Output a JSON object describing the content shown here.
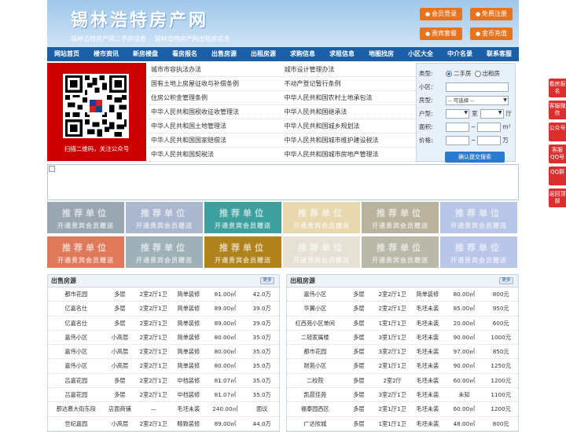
{
  "header": {
    "logo": "锡林浩特房产网",
    "sublinks": [
      "锡林浩特房产网二手房信息",
      "锡林浩特房产网出租房信息"
    ],
    "buttons": [
      {
        "label": "会员登录",
        "icon": "user-icon"
      },
      {
        "label": "免费注册",
        "icon": "user-add-icon"
      },
      {
        "label": "贵宾套餐",
        "icon": "vip-icon"
      },
      {
        "label": "金币充值",
        "icon": "coin-icon"
      }
    ]
  },
  "nav": [
    "网站首页",
    "楼市资讯",
    "新房楼盘",
    "看房报名",
    "出售房源",
    "出租房源",
    "求购信息",
    "求租信息",
    "地图找房",
    "小区大全",
    "中介名录",
    "联系客服"
  ],
  "qr": {
    "caption": "扫描二维码，关注公众号"
  },
  "links": {
    "left": [
      "城市市容执法办法",
      "国有土地上房屋征收与补偿条例",
      "住房公积金管理条例",
      "中华人民共和国税收征收管理法",
      "中华人民共和国土地管理法",
      "中华人民共和国国家赔偿法",
      "中华人民共和国契税法"
    ],
    "right": [
      "城市设计管理办法",
      "不动产登记暂行条例",
      "中华人民共和国农村土地承包法",
      "中华人民共和国继承法",
      "中华人民共和国城乡规划法",
      "中华人民共和国城市维护建设税法",
      "中华人民共和国城市房地产管理法"
    ]
  },
  "search": {
    "type_label": "类型:",
    "type_options": [
      "二手房",
      "出租房"
    ],
    "community_label": "小区:",
    "housetype_label": "房型:",
    "housetype_value": "-- 可选择 --",
    "layout_label": "户型:",
    "room_unit": "室",
    "hall_unit": "厅",
    "area_label": "面积:",
    "area_unit": "m²",
    "price_label": "价格:",
    "range_sep": "~",
    "price_unit": "万",
    "submit": "确认提交搜索"
  },
  "ads": {
    "title": "推荐单位",
    "subtitle": "开通贵宾会员赠送",
    "colors": [
      "#9aa6b2",
      "#abb6cf",
      "#3e9f9f",
      "#e8d8b0",
      "#b9b29d",
      "#b7c6e6",
      "#e0785a",
      "#9fb1b8",
      "#b0821c",
      "#e6e1d4",
      "#b9b8a9",
      "#b9c6e9"
    ]
  },
  "sale": {
    "title": "出售房源",
    "more": "更多",
    "rows": [
      [
        "都市花园",
        "多层",
        "2室2厅1卫",
        "简单装修",
        "81.00㎡",
        "42.0万"
      ],
      [
        "亿嘉名仕",
        "多层",
        "2室2厅1卫",
        "简单装修",
        "89.00㎡",
        "39.0万"
      ],
      [
        "亿嘉名仕",
        "多层",
        "2室2厅1卫",
        "简单装修",
        "89.00㎡",
        "39.0万"
      ],
      [
        "嘉伟小区",
        "小高层",
        "2室2厅1卫",
        "简单装修",
        "80.00㎡",
        "35.0万"
      ],
      [
        "嘉伟小区",
        "小高层",
        "2室2厅1卫",
        "简单装修",
        "80.00㎡",
        "35.0万"
      ],
      [
        "嘉伟小区",
        "小高层",
        "2室2厅1卫",
        "简单装修",
        "80.00㎡",
        "35.0万"
      ],
      [
        "吕嘉花园",
        "多层",
        "2室2厅1卫",
        "中档装修",
        "81.07㎡",
        "35.0万"
      ],
      [
        "吕嘉花园",
        "多层",
        "2室2厅1卫",
        "中档装修",
        "81.07㎡",
        "35.0万"
      ],
      [
        "那达慕大街东段",
        "店面商铺",
        "—",
        "毛坯未装",
        "240.00㎡",
        "面议"
      ],
      [
        "世纪嘉园",
        "小高层",
        "2室2厅1卫",
        "精致装修",
        "89.00㎡",
        "44.0万"
      ]
    ]
  },
  "rent": {
    "title": "出租房源",
    "more": "更多",
    "rows": [
      [
        "嘉伟小区",
        "多层",
        "2室2厅1卫",
        "简单装修",
        "80.00㎡",
        "800元"
      ],
      [
        "华翼小区",
        "多层",
        "2室2厅1卫",
        "毛坯未装",
        "85.00㎡",
        "950元"
      ],
      [
        "红西苑小区单间",
        "多层",
        "1室1厅1卫",
        "毛坯未装",
        "20.00㎡",
        "600元"
      ],
      [
        "二轻家属楼",
        "多层",
        "3室1厅1卫",
        "毛坯未装",
        "90.00㎡",
        "1000元"
      ],
      [
        "都市花园",
        "多层",
        "3室2厅1卫",
        "毛坯未装",
        "97.00㎡",
        "850元"
      ],
      [
        "财苑小区",
        "多层",
        "2室1厅1卫",
        "毛坯未装",
        "90.00㎡",
        "1250元"
      ],
      [
        "二校院",
        "多层",
        "2室2厅",
        "毛坯未装",
        "60.00㎡",
        "1200元"
      ],
      [
        "凯晨佳苑",
        "多层",
        "3室2厅1卫",
        "毛坯未装",
        "未知",
        "1100元"
      ],
      [
        "福泰园西区",
        "多层",
        "2室1厅1卫",
        "毛坯未装",
        "60.00㎡",
        "1200元"
      ],
      [
        "广达欣城",
        "多层",
        "1室1厅1卫",
        "毛坯未装",
        "48.00㎡",
        "800元"
      ]
    ]
  },
  "sidebar": [
    "看房报名",
    "客服微信",
    "公众号",
    "客服QQ号",
    "QQ群",
    "返回顶部"
  ]
}
